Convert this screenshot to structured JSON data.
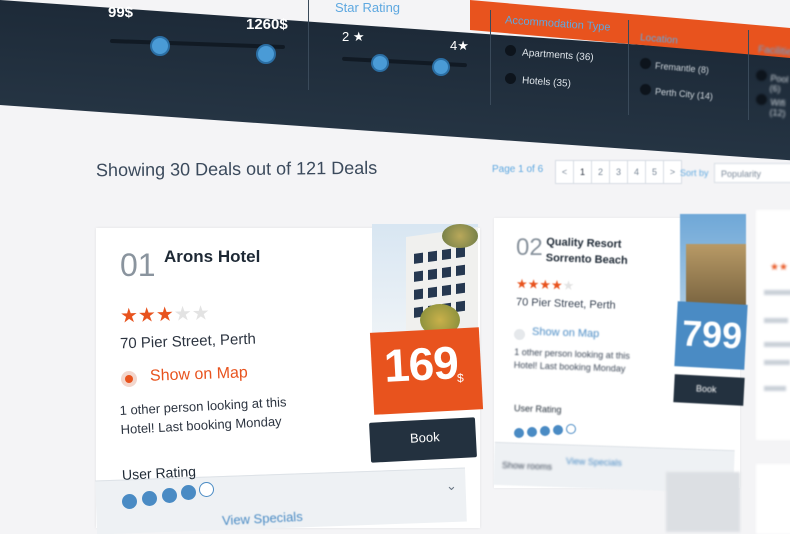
{
  "filters": {
    "price": {
      "min_label": "99$",
      "max_label": "1260$"
    },
    "star_rating": {
      "title": "Star Rating",
      "min_label": "2",
      "max_label": "4",
      "star_glyph": "★"
    },
    "accommodation": {
      "title": "Accommodation Type",
      "options": [
        {
          "label": "Apartments (36)"
        },
        {
          "label": "Hotels (35)"
        }
      ]
    },
    "location": {
      "title": "Location",
      "options": [
        {
          "label": "Fremantle (8)"
        },
        {
          "label": "Perth City (14)"
        }
      ]
    },
    "far_right": {
      "title": "Facilities",
      "options": [
        {
          "label": "Pool (6)"
        },
        {
          "label": "Wifi (12)"
        }
      ]
    }
  },
  "results": {
    "showing_text": "Showing 30 Deals out of 121 Deals",
    "page_info": "Page 1 of 6",
    "pages": [
      "<",
      "1",
      "2",
      "3",
      "4",
      "5",
      ">"
    ],
    "sort_label": "Sort by",
    "sort_value": "Popularity"
  },
  "hotels": [
    {
      "number": "01",
      "name": "Arons Hotel",
      "stars_filled": 3,
      "stars_total": 5,
      "address": "70 Pier Street, Perth",
      "map_link": "Show on Map",
      "looking_text": "1 other person looking at this Hotel! Last booking Monday",
      "user_rating_label": "User Rating",
      "user_rating_filled": 4,
      "user_rating_total": 5,
      "price": "169",
      "currency": "$",
      "book_label": "Book",
      "special_label": "View Specials"
    },
    {
      "number": "02",
      "name": "Quality Resort Sorrento Beach",
      "stars_filled": 4,
      "stars_total": 5,
      "address": "70 Pier Street, Perth",
      "map_link": "Show on Map",
      "looking_text": "1 other person looking at this Hotel! Last booking Monday",
      "user_rating_label": "User Rating",
      "user_rating_filled": 4,
      "user_rating_total": 5,
      "price": "799",
      "book_label": "Book",
      "rooms_label": "Show rooms",
      "special_label": "View Specials"
    }
  ],
  "colors": {
    "accent_orange": "#e8531e",
    "accent_blue": "#4a8bc4",
    "topbar": "#1d2a38"
  }
}
